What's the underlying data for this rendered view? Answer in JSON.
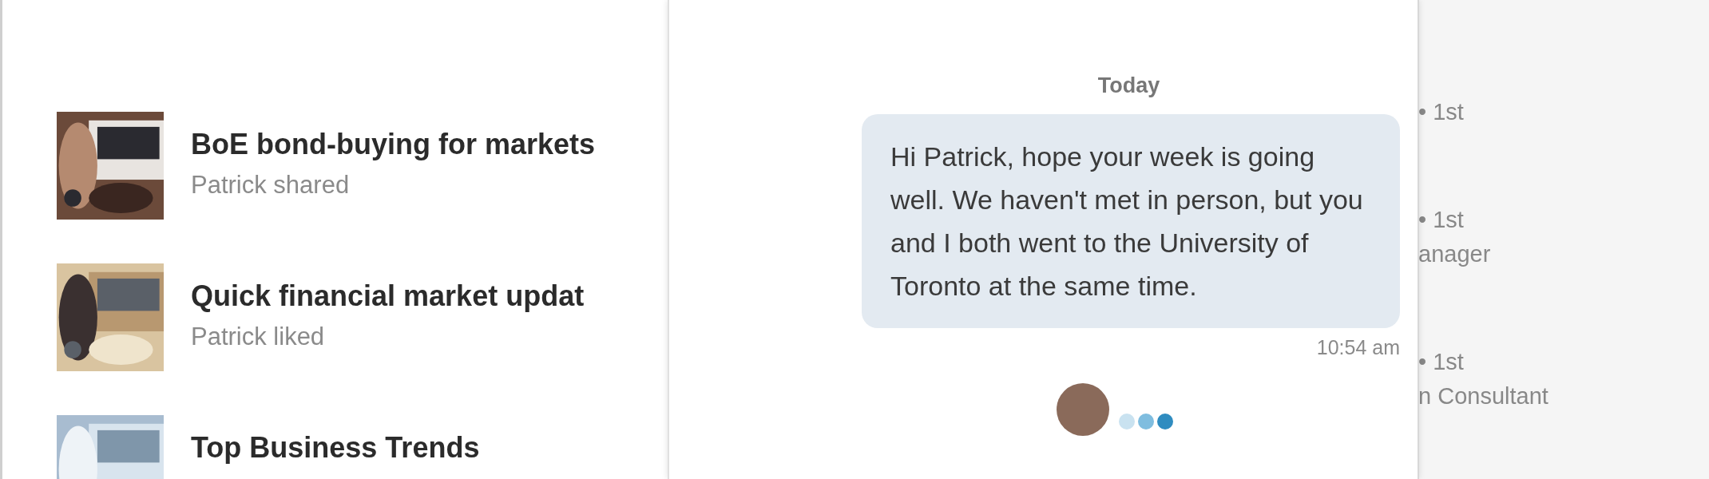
{
  "articles": [
    {
      "title": "BoE bond-buying for markets",
      "activity": "Patrick shared",
      "kind": "picture"
    },
    {
      "title": "Quick financial market updat",
      "activity": "Patrick liked",
      "kind": "picture"
    },
    {
      "title": "Top Business Trends",
      "kind": "picture"
    }
  ],
  "chat": {
    "date": "Today",
    "messages": [
      {
        "text": "Hi Patrick, hope your week is going well. We haven't met in person, but you and I both went to the University of Toronto at the same time.",
        "time": "10:54 am",
        "outgoing": true
      }
    ],
    "typing": true
  },
  "connections": [
    {
      "degree": "• 1st"
    },
    {
      "degree": "• 1st",
      "headline": "anager"
    },
    {
      "degree": "• 1st",
      "headline": "n Consultant"
    }
  ]
}
